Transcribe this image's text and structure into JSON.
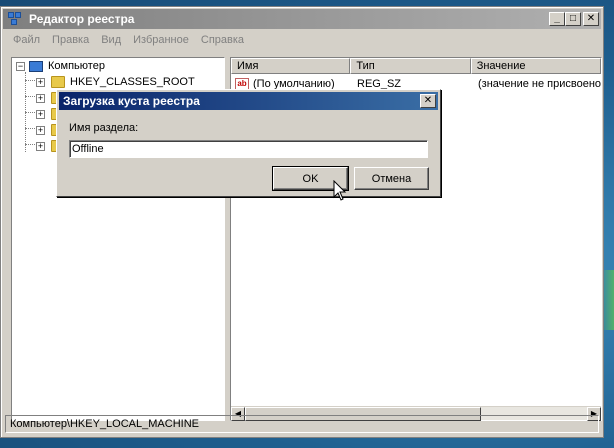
{
  "window": {
    "title": "Редактор реестра",
    "minimize": "_",
    "maximize": "□",
    "close": "✕",
    "icon": "regedit-icon"
  },
  "menu": [
    "Файл",
    "Правка",
    "Вид",
    "Избранное",
    "Справка"
  ],
  "tree": {
    "root": "Компьютер",
    "items": [
      {
        "label": "HKEY_CLASSES_ROOT",
        "expander": "+"
      },
      {
        "label": "",
        "expander": "+"
      },
      {
        "label": "",
        "expander": "+"
      },
      {
        "label": "",
        "expander": "+"
      },
      {
        "label": "",
        "expander": "+"
      }
    ],
    "root_expander": "−"
  },
  "list": {
    "columns": [
      "Имя",
      "Тип",
      "Значение"
    ],
    "rows": [
      {
        "name": "(По умолчанию)",
        "type": "REG_SZ",
        "value": "(значение не присвоено",
        "icon": "string-value-icon",
        "icon_text": "ab"
      }
    ]
  },
  "scroll": {
    "left": "◀",
    "right": "▶"
  },
  "statusbar": "Компьютер\\HKEY_LOCAL_MACHINE",
  "dialog": {
    "title": "Загрузка куста реестра",
    "close": "✕",
    "label": "Имя раздела:",
    "input_value": "Offline",
    "ok": "OK",
    "cancel": "Отмена"
  }
}
